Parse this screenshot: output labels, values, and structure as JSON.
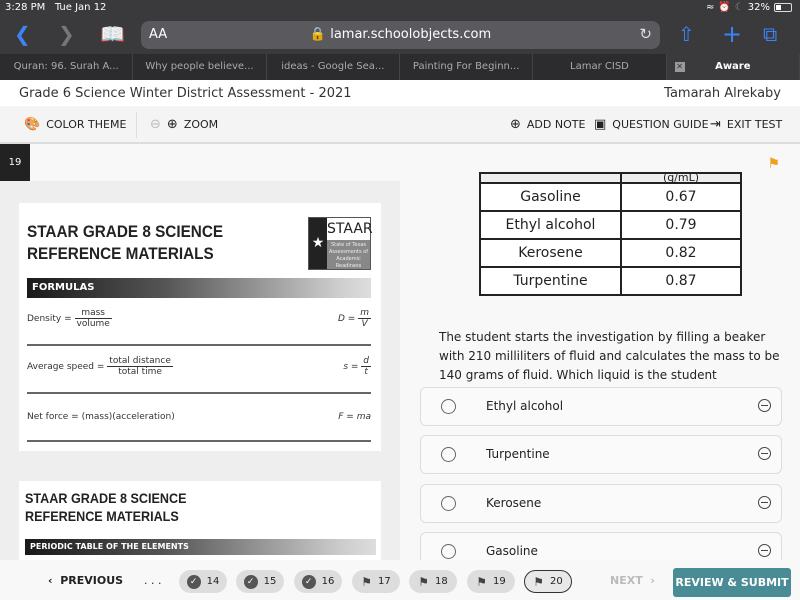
{
  "status_bar": {
    "time": "3:28 PM",
    "date": "Tue Jan 12",
    "battery": "32%",
    "battery_level": 0.32
  },
  "browser": {
    "text_size_label": "AA",
    "url": "lamar.schoolobjects.com",
    "tabs": [
      {
        "label": "Quran: 96. Surah A..."
      },
      {
        "label": "Why people believe..."
      },
      {
        "label": "ideas - Google Sea..."
      },
      {
        "label": "Painting For Beginn..."
      },
      {
        "label": "Lamar CISD"
      },
      {
        "label": "Aware",
        "active": true
      }
    ]
  },
  "app": {
    "title": "Grade 6 Science Winter District Assessment - 2021",
    "user": "Tamarah Alrekaby",
    "toolbar": {
      "color_theme": "COLOR THEME",
      "zoom": "ZOOM",
      "add_note": "ADD NOTE",
      "question_guide": "QUESTION GUIDE",
      "exit_test": "EXIT TEST"
    },
    "question_number": "19"
  },
  "reference": {
    "card1": {
      "title_line1": "STAAR GRADE 8 SCIENCE",
      "title_line2": "REFERENCE MATERIALS",
      "logo_text": "STAAR",
      "logo_sub": "State of Texas Assessments of Academic Readiness",
      "section": "FORMULAS",
      "formulas": [
        {
          "name": "Density =",
          "num": "mass",
          "den": "volume",
          "sym": "D =",
          "sym_num": "m",
          "sym_den": "V"
        },
        {
          "name": "Average speed =",
          "num": "total distance",
          "den": "total time",
          "sym": "s =",
          "sym_num": "d",
          "sym_den": "t"
        },
        {
          "name": "Net force = (mass)(acceleration)",
          "sym": "F = ma"
        }
      ]
    },
    "card2": {
      "title_line1": "STAAR GRADE 8 SCIENCE",
      "title_line2": "REFERENCE MATERIALS",
      "section": "PERIODIC TABLE OF THE ELEMENTS"
    }
  },
  "question": {
    "table_header_partial": "(g/mL)",
    "table": [
      {
        "liquid": "Gasoline",
        "density": "0.67"
      },
      {
        "liquid": "Ethyl alcohol",
        "density": "0.79"
      },
      {
        "liquid": "Kerosene",
        "density": "0.82"
      },
      {
        "liquid": "Turpentine",
        "density": "0.87"
      }
    ],
    "text": "The student starts the investigation by filling a beaker with 210 milliliters of fluid and calculates the mass to be 140 grams of fluid. Which liquid is the student measuring?",
    "choices": [
      {
        "label": "Ethyl alcohol"
      },
      {
        "label": "Turpentine"
      },
      {
        "label": "Kerosene"
      },
      {
        "label": "Gasoline"
      }
    ]
  },
  "footer": {
    "previous": "PREVIOUS",
    "ellipsis": ". . .",
    "next": "NEXT",
    "submit": "REVIEW & SUBMIT",
    "pages": [
      {
        "num": "14",
        "state": "answered"
      },
      {
        "num": "15",
        "state": "answered"
      },
      {
        "num": "16",
        "state": "answered"
      },
      {
        "num": "17",
        "state": "flagged"
      },
      {
        "num": "18",
        "state": "flagged"
      },
      {
        "num": "19",
        "state": "flagged"
      },
      {
        "num": "20",
        "state": "flagged-current"
      }
    ]
  },
  "colors": {
    "accent": "#4a8c96",
    "flag": "#f0a020",
    "ios_blue": "#3e82f7"
  }
}
